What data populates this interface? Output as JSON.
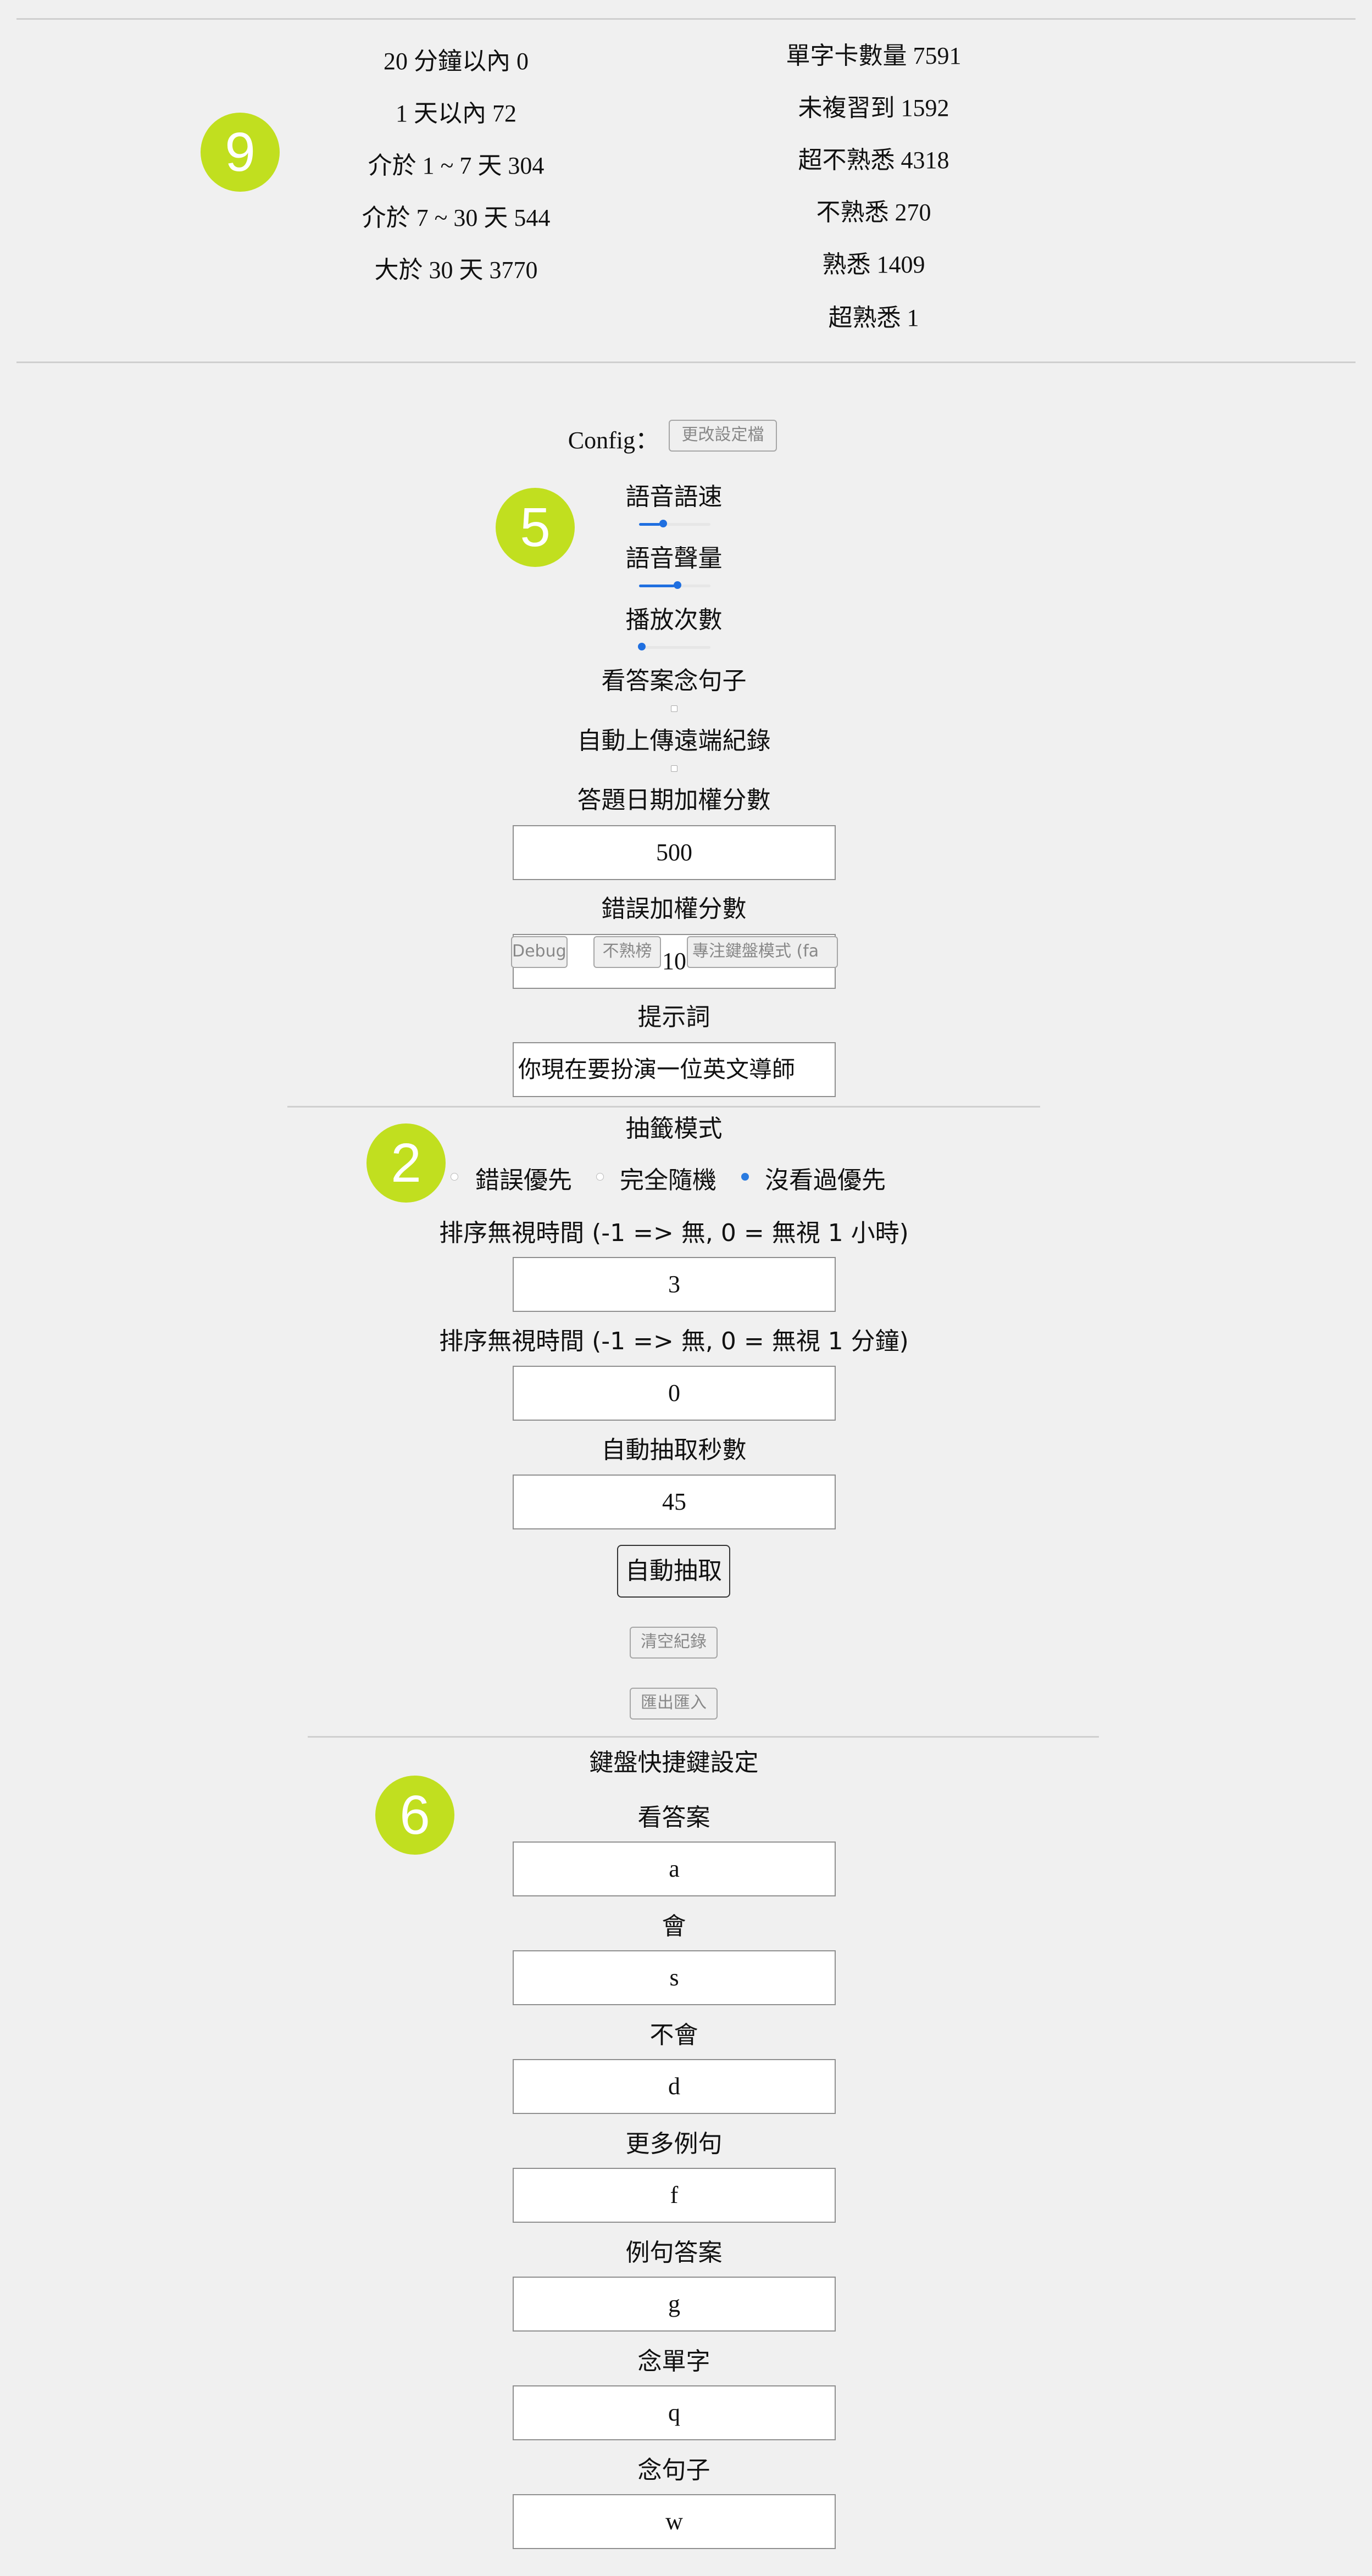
{
  "stats": {
    "left": [
      "20 分鐘以內 0",
      "1 天以內 72",
      "介於 1 ~ 7 天 304",
      "介於 7 ~ 30 天 544",
      "大於 30 天 3770"
    ],
    "right": [
      "單字卡數量 7591",
      "未複習到 1592",
      "超不熟悉 4318",
      "不熟悉 270",
      "熟悉 1409",
      "超熟悉 1"
    ]
  },
  "badges": {
    "stats": "9",
    "config": "5",
    "draw": "2",
    "keys": "6"
  },
  "colors": {
    "badge": "#c1df1f",
    "slider": "#1f6fe0"
  },
  "config": {
    "label": "Config：",
    "edit_button": "更改設定檔",
    "speech_rate_label": "語音語速",
    "speech_rate_value": 0.3,
    "speech_volume_label": "語音聲量",
    "speech_volume_value": 0.5,
    "play_count_label": "播放次數",
    "play_count_value": 0,
    "read_sentence_label": "看答案念句子",
    "auto_upload_label": "自動上傳遠端紀錄",
    "date_weight_label": "答題日期加權分數",
    "date_weight_value": "500",
    "error_weight_label": "錯誤加權分數",
    "error_weight_value": "10",
    "prompt_label": "提示詞",
    "prompt_value": "你現在要扮演一位英文導師"
  },
  "overlay_buttons": {
    "debug": "Debug",
    "unfamiliar": "不熟榜",
    "keyboard_focus": "專注鍵盤模式 (fa"
  },
  "draw": {
    "mode_label": "抽籤模式",
    "options": [
      "錯誤優先",
      "完全隨機",
      "沒看過優先"
    ],
    "selected_index": 2,
    "ignore_hours_label": "排序無視時間 (-1 => 無, 0 = 無視 1 小時)",
    "ignore_hours_value": "3",
    "ignore_minutes_label": "排序無視時間 (-1 => 無, 0 = 無視 1 分鐘)",
    "ignore_minutes_value": "0",
    "auto_seconds_label": "自動抽取秒數",
    "auto_seconds_value": "45",
    "auto_button": "自動抽取",
    "clear_button": "清空紀錄",
    "export_button": "匯出匯入"
  },
  "keys": {
    "title": "鍵盤快捷鍵設定",
    "items": [
      {
        "label": "看答案",
        "value": "a"
      },
      {
        "label": "會",
        "value": "s"
      },
      {
        "label": "不會",
        "value": "d"
      },
      {
        "label": "更多例句",
        "value": "f"
      },
      {
        "label": "例句答案",
        "value": "g"
      },
      {
        "label": "念單字",
        "value": "q"
      },
      {
        "label": "念句子",
        "value": "w"
      }
    ]
  }
}
